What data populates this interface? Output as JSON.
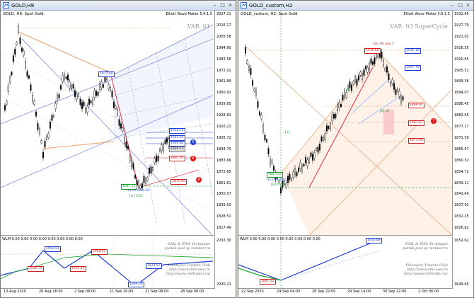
{
  "left": {
    "title": "GOLD,H8",
    "symbol_label": "GOLD, H8:  Spot Gold",
    "ewm_label": "Elliott Wave Maker 5.6.1.5",
    "var_label": "VAR. 01",
    "wlm_label": "WLM 0.00 0.00 0.00 0.00 0.00 0.00 0.00 0.00",
    "brand_lines": [
      "DML & EWA Technique",
      "putnik-post @ rambler.ru",
      "Fibonacci  Traders  Club",
      "http://www.dml-ewa.ru",
      "http://www.redtrader.ru/"
    ],
    "y_ticks": [
      "2027.21",
      "2016.17",
      "2005.58",
      "1994.60",
      "1983.56",
      "1972.91",
      "1961.89",
      "1950.92",
      "1939.85",
      "1928.82",
      "1916.21",
      "1905.72",
      "1894.70",
      "1883.66",
      "1872.65",
      "1861.61",
      "1850.57",
      "1839.53",
      "1828.51",
      "1817.49"
    ],
    "sub_y_ticks": [
      "2032.30",
      "2020.21"
    ],
    "x_ticks": [
      "13 Aug 2020",
      "26 Aug 16:00",
      "2 Sep 08:00",
      "11 Sep 16:00",
      "21 Sep 08:00",
      "28 Sep 08:00"
    ],
    "price_labels": [
      {
        "text": "1918.22",
        "color": "blue"
      },
      {
        "text": "1911.83",
        "color": "blue"
      },
      {
        "text": "1905.82",
        "color": "blue"
      },
      {
        "text": "1899.23",
        "color": "gray"
      },
      {
        "text": "1892.07",
        "color": "red"
      },
      {
        "text": "1870.65",
        "color": "red"
      },
      {
        "text": "1847.53",
        "color": "green"
      },
      {
        "text": "1972.69",
        "color": "blue"
      }
    ],
    "circles": [
      {
        "text": "5",
        "color": "blue"
      },
      {
        "text": "6",
        "color": "red"
      },
      {
        "text": "8",
        "color": "red"
      }
    ],
    "sub_labels": [
      {
        "text": "1992.93",
        "color": "blue"
      },
      {
        "text": "1928.79",
        "color": "red"
      },
      {
        "text": "1919.44",
        "color": "red"
      },
      {
        "text": "1899.00",
        "color": "blue"
      },
      {
        "text": "1924.87",
        "color": "blue"
      },
      {
        "text": "1968.65",
        "color": "red"
      }
    ],
    "notes": [
      "(2) (IV) ext.3",
      "[iv] CZZ",
      "(c) (IV) ext.3/1"
    ]
  },
  "right": {
    "title": "GOLD_custom,H2",
    "symbol_label": "GOLD_custom, H2:  Spot Gold",
    "ewm_label": "Elliott Wave Maker 5.6.1.5",
    "var_label": "VAR. 03 SuperCycle",
    "wlm_label": "WLM 0.00 0.00 0.00 0.00 0.00 0.00 0.00 0.00",
    "brand_lines": [
      "DML & EWA Technique",
      "putnik-post @ rambler.ru",
      "Fibonacci  Traders  Club",
      "http://www.dml-ewa.ru",
      "http://www.redtrader.ru/"
    ],
    "y_ticks": [
      "1932.95",
      "1927.79",
      "1921.02",
      "1916.55",
      "1910.65",
      "1905.31",
      "1899.36",
      "1894.07",
      "1888.45",
      "1882.65",
      "1877.17",
      "1871.59",
      "1865.97",
      "1860.32",
      "1854.72",
      "1849.11",
      "1843.49",
      "1837.92",
      "1832.25",
      "1826.62"
    ],
    "sub_y_ticks": [
      "1652.62",
      "1649.65"
    ],
    "x_ticks": [
      "22 Sep 2020",
      "24 Sep 04:00",
      "28 Sep 22:00",
      "29 Sep 14:00",
      "30 Sep 22:00",
      "2 Oct 06:00"
    ],
    "price_labels": [
      {
        "text": "1916.18",
        "color": "blue"
      },
      {
        "text": "1916.68",
        "color": "red"
      },
      {
        "text": "1907.74",
        "color": "blue"
      },
      {
        "text": "1889.92",
        "color": "red"
      },
      {
        "text": "1881.61",
        "color": "red"
      },
      {
        "text": "1873.08",
        "color": "red"
      },
      {
        "text": "1847.22",
        "color": "green"
      },
      {
        "text": "1916.68",
        "color": "blue"
      },
      {
        "text": "1847.22",
        "color": "red"
      }
    ],
    "circles": [
      {
        "text": "7",
        "color": "red"
      }
    ],
    "notes": [
      "(3) (IV) ext.3",
      "(c) (IV) ext.3",
      "[iv] CZZ",
      "[1]",
      "[ii] ST",
      "[ii]"
    ]
  }
}
